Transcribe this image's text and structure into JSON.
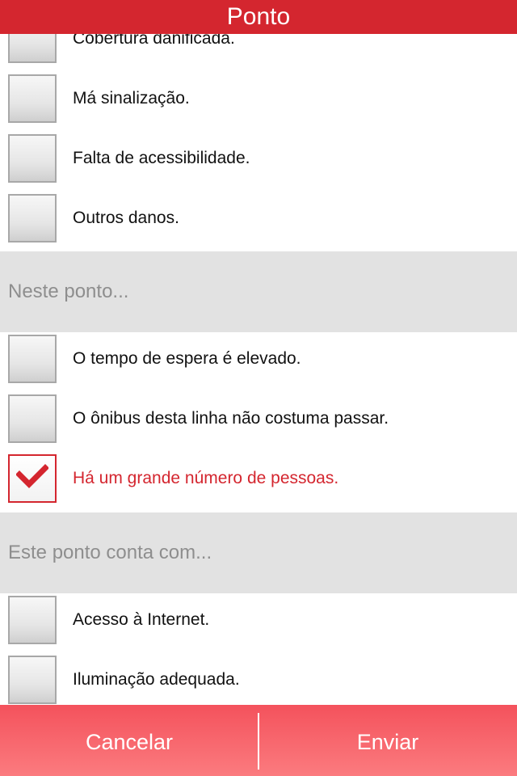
{
  "header": {
    "title": "Ponto"
  },
  "items_top": [
    {
      "label": "Cobertura danificada.",
      "checked": false
    },
    {
      "label": "Má sinalização.",
      "checked": false
    },
    {
      "label": "Falta de acessibilidade.",
      "checked": false
    },
    {
      "label": "Outros danos.",
      "checked": false
    }
  ],
  "section_neste": {
    "title": "Neste ponto..."
  },
  "items_neste": [
    {
      "label": "O tempo de espera é elevado.",
      "checked": false
    },
    {
      "label": "O ônibus desta linha não costuma passar.",
      "checked": false
    },
    {
      "label": "Há um grande número de pessoas.",
      "checked": true
    }
  ],
  "section_este": {
    "title": "Este ponto conta com..."
  },
  "items_este": [
    {
      "label": "Acesso à Internet.",
      "checked": false
    },
    {
      "label": "Iluminação adequada.",
      "checked": false
    }
  ],
  "footer": {
    "cancel_label": "Cancelar",
    "send_label": "Enviar"
  },
  "colors": {
    "accent": "#d4262f",
    "section_bg": "#e2e2e2",
    "bottom_bar": "#f96a70"
  },
  "icons": {
    "checkmark": "checkmark-icon"
  }
}
